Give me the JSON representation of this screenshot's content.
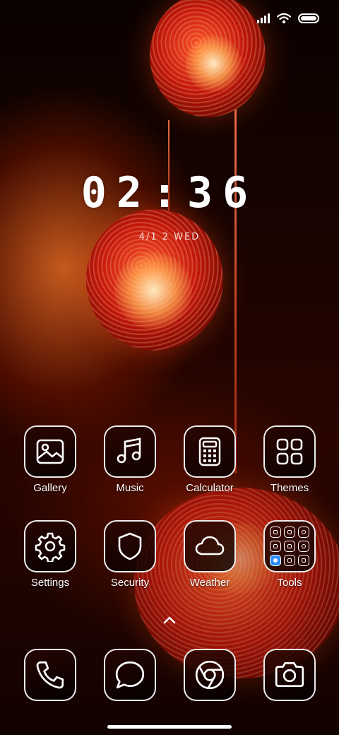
{
  "status_bar": {
    "icons": [
      "signal-icon",
      "wifi-icon",
      "battery-icon"
    ],
    "battery_level": 1.0
  },
  "clock": {
    "time": "02:36",
    "date": "4/1 2 WED"
  },
  "apps_row1": [
    {
      "label": "Gallery",
      "icon": "gallery-icon"
    },
    {
      "label": "Music",
      "icon": "music-icon"
    },
    {
      "label": "Calculator",
      "icon": "calculator-icon"
    },
    {
      "label": "Themes",
      "icon": "themes-icon"
    }
  ],
  "apps_row2": [
    {
      "label": "Settings",
      "icon": "gear-icon"
    },
    {
      "label": "Security",
      "icon": "shield-icon"
    },
    {
      "label": "Weather",
      "icon": "cloud-icon"
    },
    {
      "label": "Tools",
      "icon": "folder-icon"
    }
  ],
  "dock": [
    {
      "icon": "phone-icon"
    },
    {
      "icon": "message-icon"
    },
    {
      "icon": "browser-icon"
    },
    {
      "icon": "camera-icon"
    }
  ],
  "colors": {
    "accent": "#ffffff",
    "wallpaper": "#c4180c",
    "folder_highlight": "#2b8bff"
  }
}
